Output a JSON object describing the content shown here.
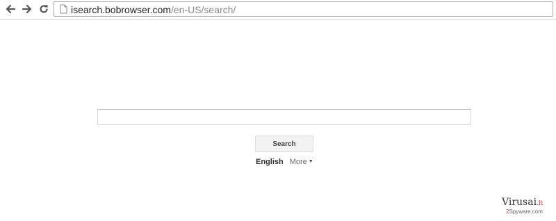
{
  "browser": {
    "url_host": "isearch.bobrowser.com",
    "url_path": "/en-US/search/"
  },
  "search": {
    "input_value": "",
    "button_label": "Search"
  },
  "languages": {
    "current": "English",
    "more_label": "More",
    "more_caret": "▼"
  },
  "watermark": {
    "main": "Virusai",
    "tld": ".lt",
    "sub_mark": "2",
    "sub_text": "Spyware.com"
  },
  "colors": {
    "brand_accent": "#e0312f",
    "toolbar_border": "#d6d6d6",
    "button_bg": "#f2f2f2"
  }
}
